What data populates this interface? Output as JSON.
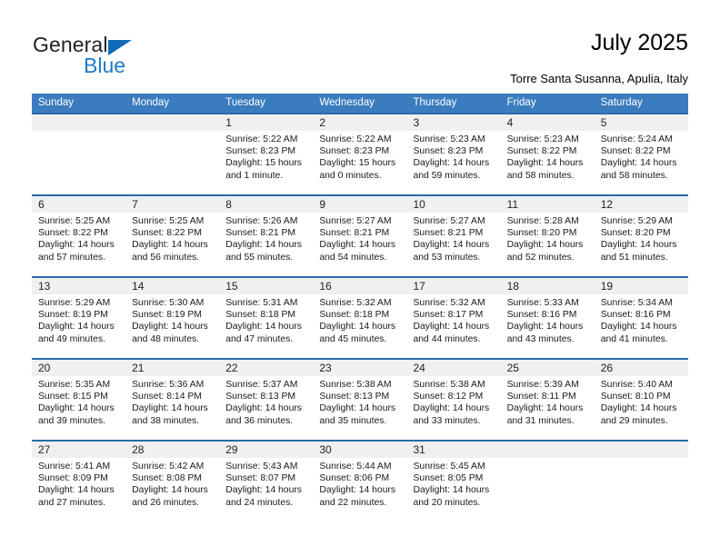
{
  "brand": {
    "name_top": "General",
    "name_bottom": "Blue",
    "triangle_color": "#0f6bb5",
    "blue_color": "#1f7bc4"
  },
  "header": {
    "title": "July 2025",
    "subtitle": "Torre Santa Susanna, Apulia, Italy"
  },
  "theme": {
    "header_blue": "#3a7cbe",
    "row_divider_blue": "#2a6ba8",
    "daynum_band": "#f0f0f0"
  },
  "weekdays": [
    "Sunday",
    "Monday",
    "Tuesday",
    "Wednesday",
    "Thursday",
    "Friday",
    "Saturday"
  ],
  "weeks": [
    [
      {
        "day": "",
        "sunrise": "",
        "sunset": "",
        "daylight": ""
      },
      {
        "day": "",
        "sunrise": "",
        "sunset": "",
        "daylight": ""
      },
      {
        "day": "1",
        "sunrise": "Sunrise: 5:22 AM",
        "sunset": "Sunset: 8:23 PM",
        "daylight": "Daylight: 15 hours and 1 minute."
      },
      {
        "day": "2",
        "sunrise": "Sunrise: 5:22 AM",
        "sunset": "Sunset: 8:23 PM",
        "daylight": "Daylight: 15 hours and 0 minutes."
      },
      {
        "day": "3",
        "sunrise": "Sunrise: 5:23 AM",
        "sunset": "Sunset: 8:23 PM",
        "daylight": "Daylight: 14 hours and 59 minutes."
      },
      {
        "day": "4",
        "sunrise": "Sunrise: 5:23 AM",
        "sunset": "Sunset: 8:22 PM",
        "daylight": "Daylight: 14 hours and 58 minutes."
      },
      {
        "day": "5",
        "sunrise": "Sunrise: 5:24 AM",
        "sunset": "Sunset: 8:22 PM",
        "daylight": "Daylight: 14 hours and 58 minutes."
      }
    ],
    [
      {
        "day": "6",
        "sunrise": "Sunrise: 5:25 AM",
        "sunset": "Sunset: 8:22 PM",
        "daylight": "Daylight: 14 hours and 57 minutes."
      },
      {
        "day": "7",
        "sunrise": "Sunrise: 5:25 AM",
        "sunset": "Sunset: 8:22 PM",
        "daylight": "Daylight: 14 hours and 56 minutes."
      },
      {
        "day": "8",
        "sunrise": "Sunrise: 5:26 AM",
        "sunset": "Sunset: 8:21 PM",
        "daylight": "Daylight: 14 hours and 55 minutes."
      },
      {
        "day": "9",
        "sunrise": "Sunrise: 5:27 AM",
        "sunset": "Sunset: 8:21 PM",
        "daylight": "Daylight: 14 hours and 54 minutes."
      },
      {
        "day": "10",
        "sunrise": "Sunrise: 5:27 AM",
        "sunset": "Sunset: 8:21 PM",
        "daylight": "Daylight: 14 hours and 53 minutes."
      },
      {
        "day": "11",
        "sunrise": "Sunrise: 5:28 AM",
        "sunset": "Sunset: 8:20 PM",
        "daylight": "Daylight: 14 hours and 52 minutes."
      },
      {
        "day": "12",
        "sunrise": "Sunrise: 5:29 AM",
        "sunset": "Sunset: 8:20 PM",
        "daylight": "Daylight: 14 hours and 51 minutes."
      }
    ],
    [
      {
        "day": "13",
        "sunrise": "Sunrise: 5:29 AM",
        "sunset": "Sunset: 8:19 PM",
        "daylight": "Daylight: 14 hours and 49 minutes."
      },
      {
        "day": "14",
        "sunrise": "Sunrise: 5:30 AM",
        "sunset": "Sunset: 8:19 PM",
        "daylight": "Daylight: 14 hours and 48 minutes."
      },
      {
        "day": "15",
        "sunrise": "Sunrise: 5:31 AM",
        "sunset": "Sunset: 8:18 PM",
        "daylight": "Daylight: 14 hours and 47 minutes."
      },
      {
        "day": "16",
        "sunrise": "Sunrise: 5:32 AM",
        "sunset": "Sunset: 8:18 PM",
        "daylight": "Daylight: 14 hours and 45 minutes."
      },
      {
        "day": "17",
        "sunrise": "Sunrise: 5:32 AM",
        "sunset": "Sunset: 8:17 PM",
        "daylight": "Daylight: 14 hours and 44 minutes."
      },
      {
        "day": "18",
        "sunrise": "Sunrise: 5:33 AM",
        "sunset": "Sunset: 8:16 PM",
        "daylight": "Daylight: 14 hours and 43 minutes."
      },
      {
        "day": "19",
        "sunrise": "Sunrise: 5:34 AM",
        "sunset": "Sunset: 8:16 PM",
        "daylight": "Daylight: 14 hours and 41 minutes."
      }
    ],
    [
      {
        "day": "20",
        "sunrise": "Sunrise: 5:35 AM",
        "sunset": "Sunset: 8:15 PM",
        "daylight": "Daylight: 14 hours and 39 minutes."
      },
      {
        "day": "21",
        "sunrise": "Sunrise: 5:36 AM",
        "sunset": "Sunset: 8:14 PM",
        "daylight": "Daylight: 14 hours and 38 minutes."
      },
      {
        "day": "22",
        "sunrise": "Sunrise: 5:37 AM",
        "sunset": "Sunset: 8:13 PM",
        "daylight": "Daylight: 14 hours and 36 minutes."
      },
      {
        "day": "23",
        "sunrise": "Sunrise: 5:38 AM",
        "sunset": "Sunset: 8:13 PM",
        "daylight": "Daylight: 14 hours and 35 minutes."
      },
      {
        "day": "24",
        "sunrise": "Sunrise: 5:38 AM",
        "sunset": "Sunset: 8:12 PM",
        "daylight": "Daylight: 14 hours and 33 minutes."
      },
      {
        "day": "25",
        "sunrise": "Sunrise: 5:39 AM",
        "sunset": "Sunset: 8:11 PM",
        "daylight": "Daylight: 14 hours and 31 minutes."
      },
      {
        "day": "26",
        "sunrise": "Sunrise: 5:40 AM",
        "sunset": "Sunset: 8:10 PM",
        "daylight": "Daylight: 14 hours and 29 minutes."
      }
    ],
    [
      {
        "day": "27",
        "sunrise": "Sunrise: 5:41 AM",
        "sunset": "Sunset: 8:09 PM",
        "daylight": "Daylight: 14 hours and 27 minutes."
      },
      {
        "day": "28",
        "sunrise": "Sunrise: 5:42 AM",
        "sunset": "Sunset: 8:08 PM",
        "daylight": "Daylight: 14 hours and 26 minutes."
      },
      {
        "day": "29",
        "sunrise": "Sunrise: 5:43 AM",
        "sunset": "Sunset: 8:07 PM",
        "daylight": "Daylight: 14 hours and 24 minutes."
      },
      {
        "day": "30",
        "sunrise": "Sunrise: 5:44 AM",
        "sunset": "Sunset: 8:06 PM",
        "daylight": "Daylight: 14 hours and 22 minutes."
      },
      {
        "day": "31",
        "sunrise": "Sunrise: 5:45 AM",
        "sunset": "Sunset: 8:05 PM",
        "daylight": "Daylight: 14 hours and 20 minutes."
      },
      {
        "day": "",
        "sunrise": "",
        "sunset": "",
        "daylight": ""
      },
      {
        "day": "",
        "sunrise": "",
        "sunset": "",
        "daylight": ""
      }
    ]
  ]
}
